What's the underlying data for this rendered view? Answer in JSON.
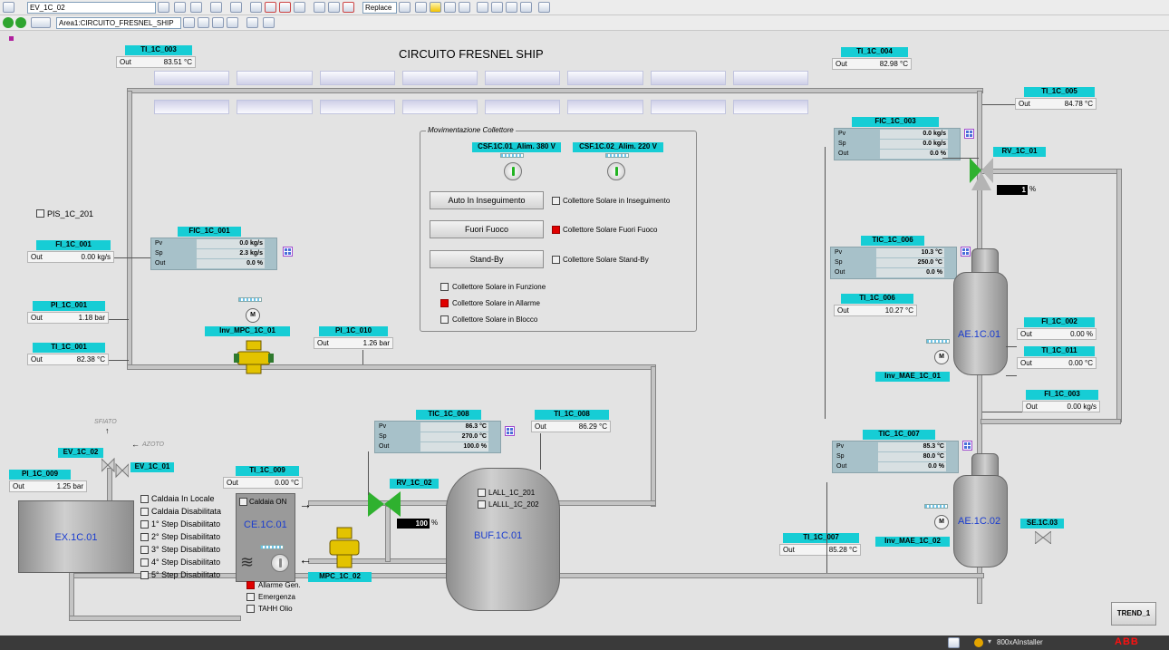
{
  "toolbar": {
    "object_field": "EV_1C_02",
    "replace_label": "Replace",
    "area_field": "Area1:CIRCUITO_FRESNEL_SHIP"
  },
  "title": "CIRCUITO FRESNEL SHIP",
  "indicators": {
    "ti_1c_003": {
      "tag": "TI_1C_003",
      "k": "Out",
      "v": "83.51 °C"
    },
    "ti_1c_004": {
      "tag": "TI_1C_004",
      "k": "Out",
      "v": "82.98 °C"
    },
    "ti_1c_005": {
      "tag": "TI_1C_005",
      "k": "Out",
      "v": "84.78 °C"
    },
    "fi_1c_001": {
      "tag": "FI_1C_001",
      "k": "Out",
      "v": "0.00 kg/s"
    },
    "pi_1c_001": {
      "tag": "PI_1C_001",
      "k": "Out",
      "v": "1.18 bar"
    },
    "ti_1c_001": {
      "tag": "TI_1C_001",
      "k": "Out",
      "v": "82.38 °C"
    },
    "pi_1c_010": {
      "tag": "PI_1C_010",
      "k": "Out",
      "v": "1.26 bar"
    },
    "ti_1c_006": {
      "tag": "TI_1C_006",
      "k": "Out",
      "v": "10.27 °C"
    },
    "fi_1c_002": {
      "tag": "FI_1C_002",
      "k": "Out",
      "v": "0.00 %"
    },
    "ti_1c_011": {
      "tag": "TI_1C_011",
      "k": "Out",
      "v": "0.00 °C"
    },
    "fi_1c_003": {
      "tag": "FI_1C_003",
      "k": "Out",
      "v": "0.00 kg/s"
    },
    "ti_1c_008": {
      "tag": "TI_1C_008",
      "k": "Out",
      "v": "86.29 °C"
    },
    "ti_1c_009": {
      "tag": "TI_1C_009",
      "k": "Out",
      "v": "0.00 °C"
    },
    "pi_1c_009": {
      "tag": "PI_1C_009",
      "k": "Out",
      "v": "1.25 bar"
    },
    "ti_1c_007": {
      "tag": "TI_1C_007",
      "k": "Out",
      "v": "85.28 °C"
    }
  },
  "controllers": {
    "fic_1c_003": {
      "tag": "FIC_1C_003",
      "pv_k": "Pv",
      "pv": "0.0 kg/s",
      "sp_k": "Sp",
      "sp": "0.0 kg/s",
      "out_k": "Out",
      "out": "0.0 %"
    },
    "fic_1c_001": {
      "tag": "FIC_1C_001",
      "pv_k": "Pv",
      "pv": "0.0 kg/s",
      "sp_k": "Sp",
      "sp": "2.3 kg/s",
      "out_k": "Out",
      "out": "0.0 %"
    },
    "tic_1c_006": {
      "tag": "TIC_1C_006",
      "pv_k": "Pv",
      "pv": "10.3 °C",
      "sp_k": "Sp",
      "sp": "250.0 °C",
      "out_k": "Out",
      "out": "0.0 %"
    },
    "tic_1c_008": {
      "tag": "TIC_1C_008",
      "pv_k": "Pv",
      "pv": "86.3 °C",
      "sp_k": "Sp",
      "sp": "270.0 °C",
      "out_k": "Out",
      "out": "100.0 %"
    },
    "tic_1c_007": {
      "tag": "TIC_1C_007",
      "pv_k": "Pv",
      "pv": "85.3 °C",
      "sp_k": "Sp",
      "sp": "80.0 °C",
      "out_k": "Out",
      "out": "0.0 %"
    }
  },
  "movimentazione": {
    "legend": "Movimentazione Collettore",
    "csf1": "CSF.1C.01_Alim. 380 V",
    "csf2": "CSF.1C.02_Alim. 220 V",
    "btn_auto": "Auto In Inseguimento",
    "btn_fuori": "Fuori Fuoco",
    "btn_standby": "Stand-By",
    "st_inseg": "Collettore Solare in Inseguimento",
    "st_fuori": "Collettore Solare Fuori Fuoco",
    "st_standby": "Collettore Solare Stand-By",
    "st_funz": "Collettore Solare in Funzione",
    "st_allarme": "Collettore Solare in Allarme",
    "st_blocco": "Collettore Solare in Blocco"
  },
  "labels": {
    "pis": "PIS_1C_201",
    "inv_mpc": "Inv_MPC_1C_01",
    "rv_1c_01": "RV_1C_01",
    "rv_1c_01_val": "1",
    "pct": "%",
    "ae_01": "AE.1C.01",
    "inv_mae_01": "Inv_MAE_1C_01",
    "ae_02": "AE.1C.02",
    "inv_mae_02": "Inv_MAE_1C_02",
    "se": "SE.1C.03",
    "rv_1c_02": "RV_1C_02",
    "rv_1c_02_val": "100",
    "buf": "BUF.1C.01",
    "lall": "LALL_1C_201",
    "lalll": "LALLL_1C_202",
    "ev_1c_02": "EV_1C_02",
    "ev_1c_01": "EV_1C_01",
    "sfiato": "SFIATO",
    "azoto": "AZOTO",
    "ex": "EX.1C.01",
    "ce": "CE.1C.01",
    "caldaia_on": "Caldaia ON",
    "mpc_1c_02": "MPC_1C_02",
    "allarme": "Allarme Gen.",
    "emergenza": "Emergenza",
    "tahh": "TAHH Olio",
    "motor": "M"
  },
  "caldaia": [
    "Caldaia In Locale",
    "Caldaia Disabilitata",
    "1° Step Disabilitato",
    "2° Step Disabilitato",
    "3° Step Disabilitato",
    "4° Step Disabilitato",
    "5° Step Disabilitato"
  ],
  "trend": "TREND_1",
  "status": {
    "user": "800xAInstaller",
    "brand": "ABB"
  },
  "colors": {
    "tag": "#16cdd5",
    "panel": "#a7c1c9",
    "alarm": "#e00000",
    "tank_text": "#1a3ccf"
  }
}
